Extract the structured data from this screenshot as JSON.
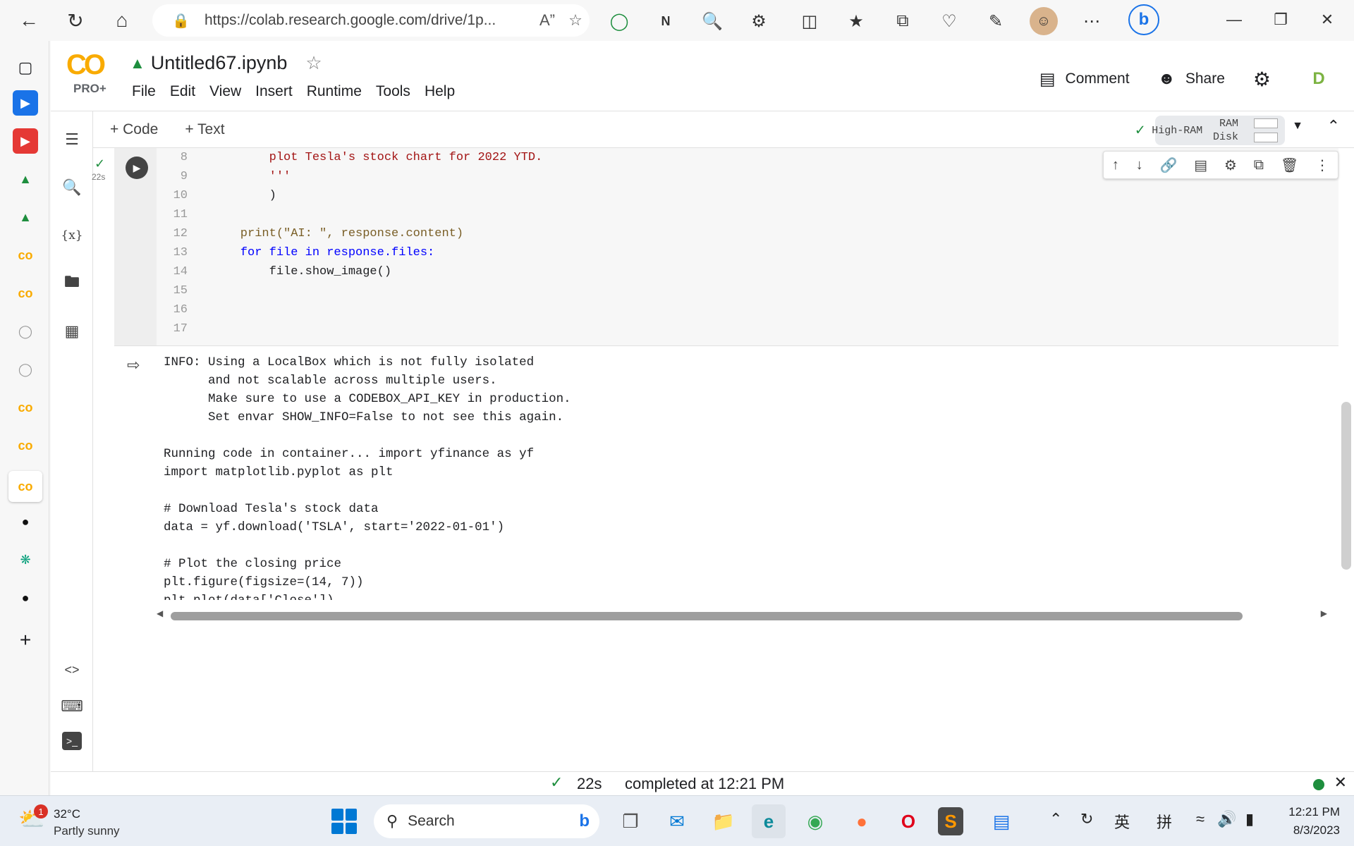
{
  "browser": {
    "url": "https://colab.research.google.com/drive/1p...",
    "read_aloud": "Ấ"
  },
  "colab": {
    "logo": "CO",
    "logo_sub": "PRO+",
    "title": "Untitled67.ipynb",
    "menu": [
      "File",
      "Edit",
      "View",
      "Insert",
      "Runtime",
      "Tools",
      "Help"
    ],
    "comment_label": "Comment",
    "share_label": "Share",
    "avatar_letter": "D",
    "add_code_label": "+ Code",
    "add_text_label": "+ Text",
    "runtime_label": "High-RAM",
    "ram_label": "RAM",
    "disk_label": "Disk"
  },
  "cell": {
    "exec_time": "22s",
    "lines": [
      {
        "n": "8",
        "text": "        plot Tesla's stock chart for 2022 YTD."
      },
      {
        "n": "9",
        "text": "        '''"
      },
      {
        "n": "10",
        "text": "        )"
      },
      {
        "n": "11",
        "text": ""
      },
      {
        "n": "12",
        "text": "    print(\"AI: \", response.content)"
      },
      {
        "n": "13",
        "text": "    for file in response.files:"
      },
      {
        "n": "14",
        "text": "        file.show_image()"
      },
      {
        "n": "15",
        "text": ""
      },
      {
        "n": "16",
        "text": ""
      },
      {
        "n": "17",
        "text": ""
      }
    ],
    "output": "INFO: Using a LocalBox which is not fully isolated\n      and not scalable across multiple users.\n      Make sure to use a CODEBOX_API_KEY in production.\n      Set envar SHOW_INFO=False to not see this again.\n\nRunning code in container... import yfinance as yf\nimport matplotlib.pyplot as plt\n\n# Download Tesla's stock data\ndata = yf.download('TSLA', start='2022-01-01')\n\n# Plot the closing price\nplt.figure(figsize=(14, 7))\nplt.plot(data['Close'])\nplt.title('Tesla Stock Price 2022 YTD')\nplt.xlabel('Date')\nplt.ylabel('Price ($)')\nplt.grid(True)\nplt.show()\nAI:  Here is the Tesla's stock price chart for 2022 year-to-date (YTD). The x-axis represents the date and the y-axis represents the closing pri"
  },
  "status": {
    "time": "22s",
    "message": "completed at 12:21 PM"
  },
  "taskbar": {
    "weather_badge": "1",
    "temp": "32°C",
    "condition": "Partly sunny",
    "search_label": "Search",
    "ime_1": "英",
    "ime_2": "拼",
    "time": "12:21 PM",
    "date": "8/3/2023"
  },
  "colors": {
    "colab_orange": "#f9ab00",
    "success_green": "#1e8e3e",
    "string_red": "#a31515",
    "keyword_blue": "#0000ff"
  }
}
